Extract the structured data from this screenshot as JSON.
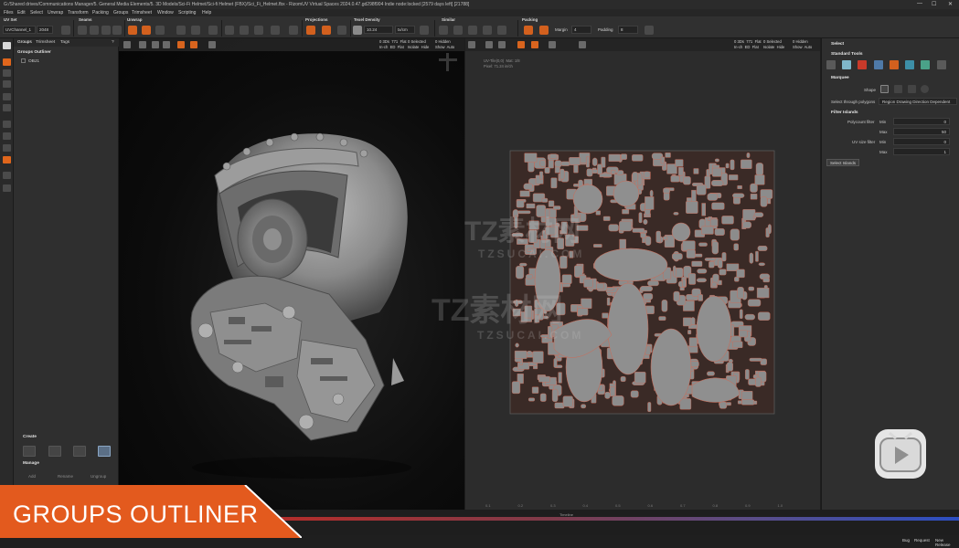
{
  "window": {
    "title": "G:/Shared drives/Communications Manager/5. General Media Elements/5. 3D Models/Sci-Fi Helmet/Sci-fi Helmet (FBX)/Sci_Fi_Helmet.fbx - RizomUV  Virtual Spaces 2024.0.47.gd298f904 Indie node:locked [2579 days left] [21788]",
    "min_glyph": "—",
    "max_glyph": "☐",
    "close_glyph": "✕"
  },
  "menu": [
    "Files",
    "Edit",
    "Select",
    "Unwrap",
    "Transform",
    "Packing",
    "Groups",
    "Trimsheet",
    "Window",
    "Scripting",
    "Help"
  ],
  "toolbar": {
    "groups": [
      "UV Set",
      "Seams",
      "Unwrap",
      "Projections",
      "Texel Density",
      "Similar",
      "Packing"
    ],
    "uvchannel": "UVChannel_1",
    "uvchannel_count": "2048",
    "texel_value": "10.24",
    "texel_unit": "tx/cm",
    "margin_label": "Margin",
    "margin_value": "4",
    "padding_label": "Padding",
    "padding_value": "8"
  },
  "left_panel": {
    "tabs": [
      "Groups",
      "Trimsheet",
      "Tags"
    ],
    "help_glyph": "?",
    "outliner_title": "Groups Outliner",
    "outliner_items": [
      "OBJ1"
    ],
    "create_title": "Create",
    "manage_title": "Manage",
    "manage_items": [
      "Add",
      "Rename",
      "Ungroup"
    ]
  },
  "viewport_3d": {
    "stats_left": "0 3Ds  771  Flat\nIn-ch  ED  Flat",
    "stats_mid": "0 Selected\nIsolate  Hide",
    "stats_right": "0 Hidden\nShow  Auto"
  },
  "viewport_uv": {
    "tile_info": "UV-Tile(0,0)  Mat: 1/8\nPixel: 71.24 in/ch",
    "stats_left": "0 3Ds  771  Flat\nIn-ch  ED  Flat",
    "stats_mid": "0 Selected\nIsolate  Hide",
    "stats_right": "0 Hidden\nShow  Auto",
    "axis_labels": [
      "0.1",
      "0.2",
      "0.3",
      "0.4",
      "0.5",
      "0.6",
      "0.7",
      "0.8",
      "0.9",
      "1.0"
    ]
  },
  "right_panel": {
    "title": "Select",
    "standard_tools": "Standard Tools",
    "marquee": "Marquee",
    "shape_label": "Shape",
    "select_through_label": "Select through polygons",
    "select_through_value": "Region Drawing Direction Dependent",
    "filter_title": "Filter Islands",
    "polycount_label": "Polycount filter",
    "uvsize_label": "UV size filter",
    "min_label": "Min",
    "max_label": "Max",
    "poly_min": "0",
    "poly_max": "50",
    "uv_min": "0",
    "uv_max": "1",
    "select_islands": "Select Islands"
  },
  "status": {
    "items": [
      "Bug",
      "Request",
      "New Release"
    ],
    "timeline_label": "Timeline"
  },
  "caption": "GROUPS OUTLINER",
  "watermarks": [
    "TZ素材网",
    "TZSUCAI.COM"
  ],
  "colors": {
    "accent": "#e0661c",
    "caption": "#e35a1e",
    "timeline_start": "#b52d2a",
    "timeline_end": "#2c4fc2"
  }
}
